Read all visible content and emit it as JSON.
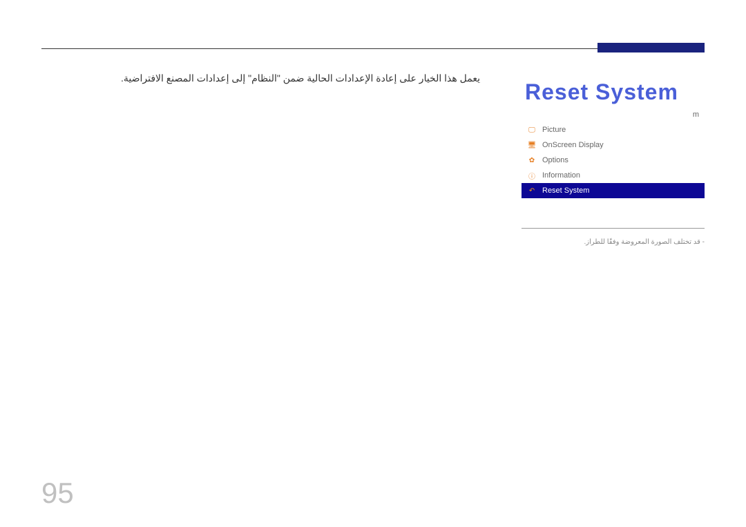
{
  "title": "Reset System",
  "main_text": "يعمل هذا الخيار على إعادة الإعدادات الحالية ضمن \"النظام\" إلى إعدادات المصنع الافتراضية.",
  "menu": {
    "items": [
      {
        "icon": "🖵",
        "label": "Picture"
      },
      {
        "icon": "🖥",
        "label": "OnScreen Display"
      },
      {
        "icon": "✿",
        "label": "Options"
      },
      {
        "icon": "ⓘ",
        "label": "Information"
      }
    ],
    "selected": {
      "icon": "↶",
      "label": "Reset System"
    },
    "last_item": "m"
  },
  "footer_note": "- قد تختلف الصورة المعروضة وفقًا للطراز.",
  "page_number": "95"
}
